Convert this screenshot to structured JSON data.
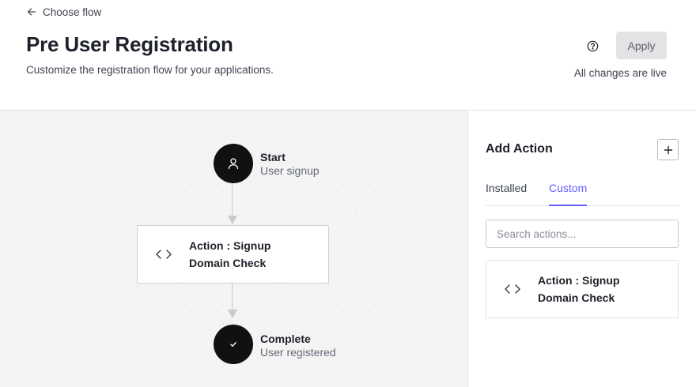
{
  "header": {
    "back_label": "Choose flow",
    "title": "Pre User Registration",
    "subtitle": "Customize the registration flow for your applications.",
    "apply_label": "Apply",
    "status": "All changes are live"
  },
  "flow": {
    "start": {
      "title": "Start",
      "subtitle": "User signup",
      "icon": "user-icon"
    },
    "action": {
      "line1": "Action : Signup",
      "line2": "Domain Check",
      "icon": "code-icon"
    },
    "complete": {
      "title": "Complete",
      "subtitle": "User registered",
      "icon": "check-icon"
    }
  },
  "panel": {
    "title": "Add Action",
    "add_icon": "plus-icon",
    "tabs": [
      {
        "label": "Installed",
        "active": false
      },
      {
        "label": "Custom",
        "active": true
      }
    ],
    "search_placeholder": "Search actions...",
    "items": [
      {
        "line1": "Action : Signup",
        "line2": "Domain Check",
        "icon": "code-icon"
      }
    ]
  },
  "colors": {
    "accent": "#635dff",
    "node": "#111111",
    "canvas": "#f4f4f5",
    "apply_bg": "#e3e3e6"
  }
}
